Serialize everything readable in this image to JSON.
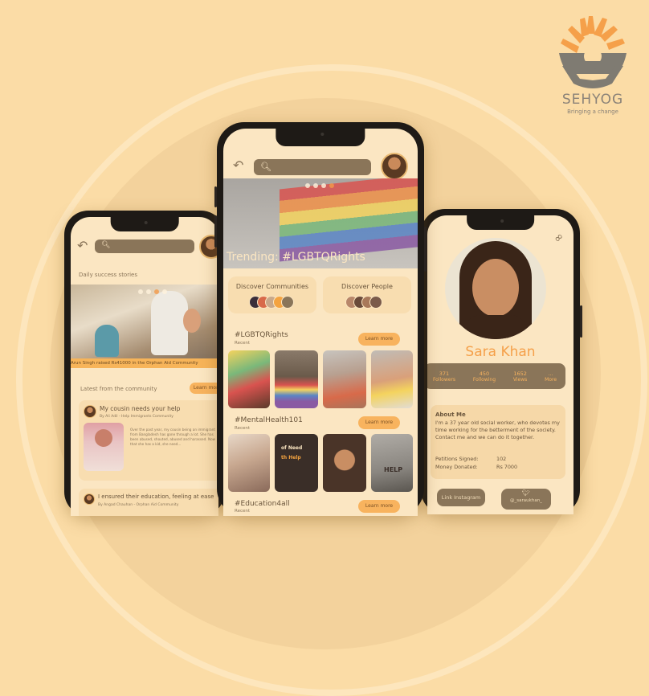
{
  "logo": {
    "name": "SEHYOG",
    "tagline": "Bringing a change"
  },
  "left_phone": {
    "section_title": "Daily success stories",
    "banner_caption": "Arun Singh raised Rs41000 in the Orphan Aid Community",
    "feed_title": "Latest from the community",
    "learn_more": "Learn more",
    "post1": {
      "title": "My cousin needs your help",
      "byline": "By Ali Adil - Help Immigrants Community",
      "body": "Over the past year, my cousin being an immigrant from Bangladesh has gone through a lot. She has been abused, shouted, abused and harassed. Now that she has a kid, she need..."
    },
    "post2": {
      "title": "I ensured their education, feeling at ease",
      "byline": "By Angad Chauhan - Orphan Aid Community"
    }
  },
  "center_phone": {
    "hero_title": "Trending: #LGBTQRights",
    "discover_communities": "Discover Communities",
    "discover_people": "Discover People",
    "sections": [
      {
        "tag": "#LGBTQRights",
        "sub": "Recent",
        "button": "Learn more"
      },
      {
        "tag": "#MentalHealth101",
        "sub": "Recent",
        "button": "Learn more"
      },
      {
        "tag": "#Education4all",
        "sub": "Recent",
        "button": "Learn more"
      }
    ],
    "tile_text_1": "of Need",
    "tile_text_2": "th Help",
    "tile_text_3": "HELP"
  },
  "right_phone": {
    "name": "Sara Khan",
    "stats": [
      {
        "value": "371",
        "label": "Followers"
      },
      {
        "value": "450",
        "label": "Following"
      },
      {
        "value": "1652",
        "label": "Views"
      },
      {
        "value": "...",
        "label": "More"
      }
    ],
    "about_title": "About Me",
    "about_text": "I'm a 37 year old social worker, who devotes my time working for the betterment of the society. Contact me and we can do it together.",
    "petitions_label": "Petitions Signed:",
    "petitions_value": "102",
    "money_label": "Money Donated:",
    "money_value": "Rs 7000",
    "link_button": "Link Instagram",
    "twitter_handle": "@_saraukhan_"
  }
}
